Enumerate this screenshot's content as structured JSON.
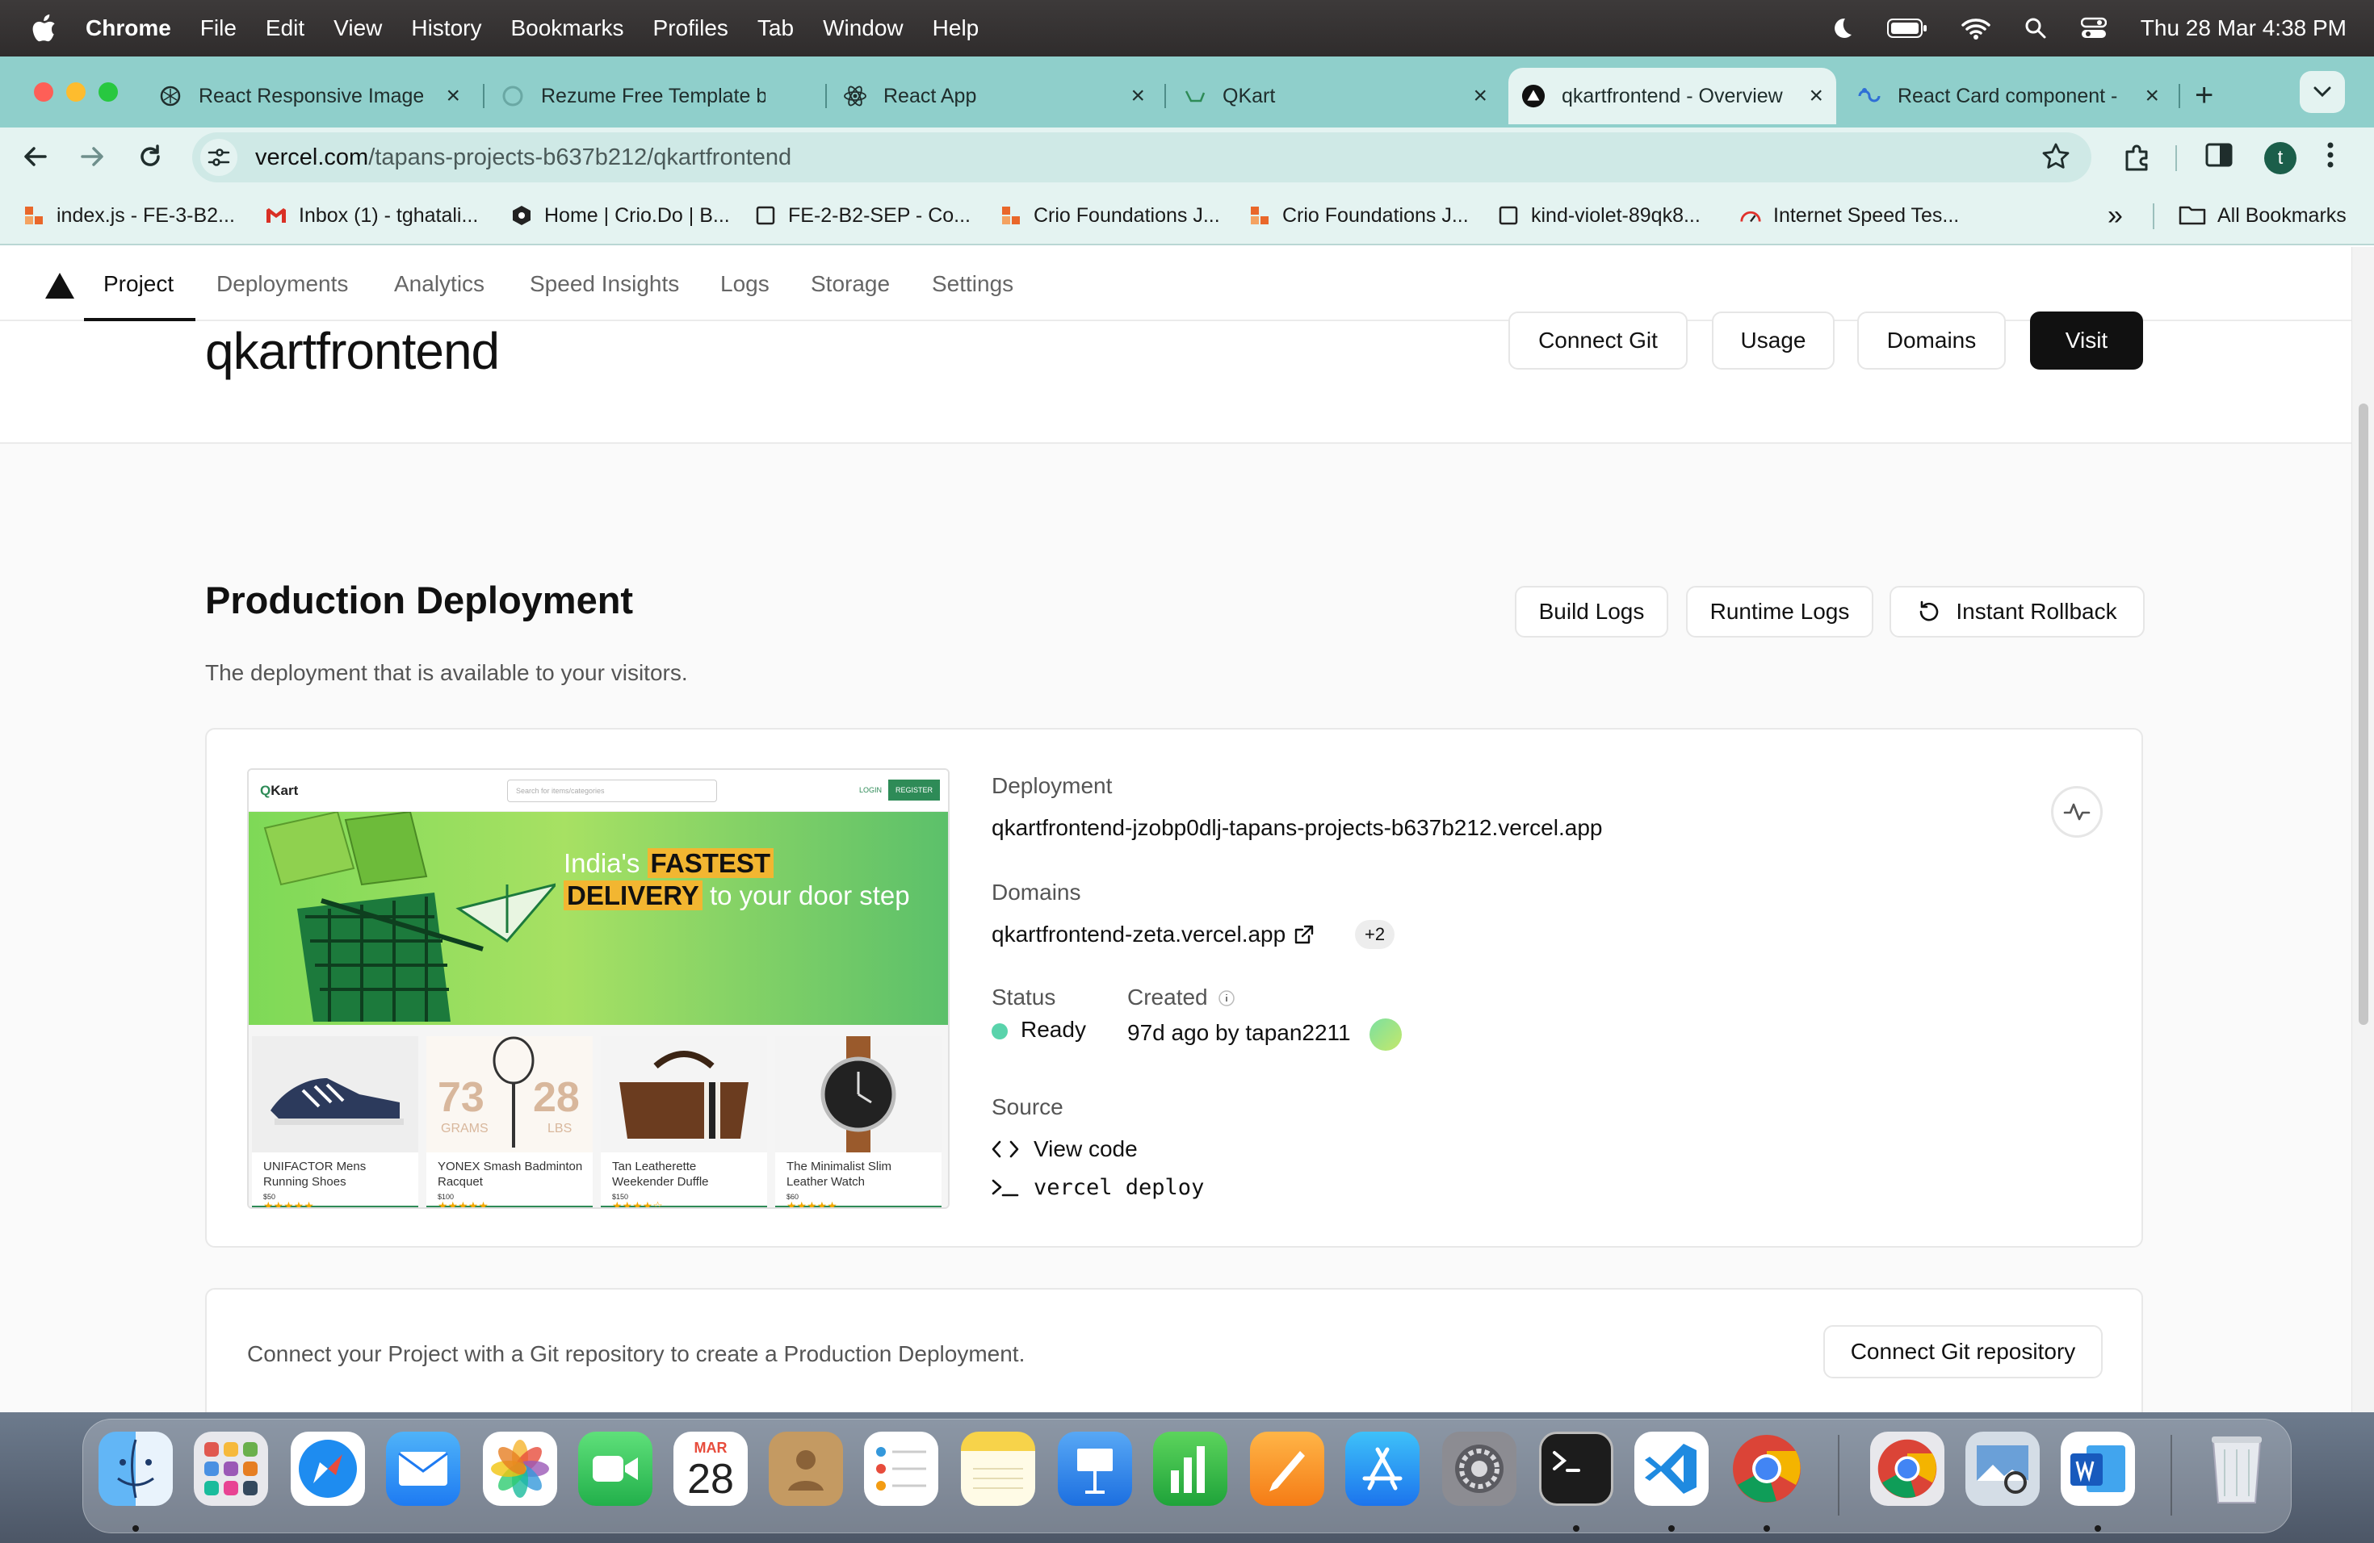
{
  "menubar": {
    "app": "Chrome",
    "items": [
      "File",
      "Edit",
      "View",
      "History",
      "Bookmarks",
      "Profiles",
      "Tab",
      "Window",
      "Help"
    ],
    "clock": "Thu 28 Mar  4:38 PM"
  },
  "tabs": [
    {
      "label": "React Responsive Image",
      "icon": "openai-icon"
    },
    {
      "label": "Rezume Free Template b",
      "icon": "loading-icon"
    },
    {
      "label": "React App",
      "icon": "react-icon"
    },
    {
      "label": "QKart",
      "icon": "qkart-icon"
    },
    {
      "label": "qkartfrontend - Overview",
      "icon": "vercel-icon",
      "active": true
    },
    {
      "label": "React Card component -",
      "icon": "react-card-icon"
    }
  ],
  "address": {
    "domain": "vercel.com",
    "path": "/tapans-projects-b637b212/qkartfrontend"
  },
  "profile_initial": "t",
  "bookmarks": {
    "items": [
      "index.js - FE-3-B2...",
      "Inbox (1) - tghatali...",
      "Home | Crio.Do | B...",
      "FE-2-B2-SEP - Co...",
      "Crio Foundations J...",
      "Crio Foundations J...",
      "kind-violet-89qk8...",
      "Internet Speed Tes..."
    ],
    "all": "All Bookmarks"
  },
  "subnav": [
    "Project",
    "Deployments",
    "Analytics",
    "Speed Insights",
    "Logs",
    "Storage",
    "Settings"
  ],
  "project": {
    "name": "qkartfrontend",
    "buttons": {
      "connect_git": "Connect Git",
      "usage": "Usage",
      "domains": "Domains",
      "visit": "Visit"
    }
  },
  "production": {
    "title": "Production Deployment",
    "description": "The deployment that is available to your visitors.",
    "buttons": {
      "build_logs": "Build Logs",
      "runtime_logs": "Runtime Logs",
      "rollback": "Instant Rollback"
    },
    "deployment_label": "Deployment",
    "deployment_url": "qkartfrontend-jzobp0dlj-tapans-projects-b637b212.vercel.app",
    "domains_label": "Domains",
    "domain": "qkartfrontend-zeta.vercel.app",
    "domain_extra": "+2",
    "status_label": "Status",
    "status": "Ready",
    "status_color": "#59d3ab",
    "created_label": "Created",
    "created": "97d ago by tapan2211",
    "source_label": "Source",
    "view_code": "View code",
    "deploy_cmd": "vercel deploy"
  },
  "preview": {
    "logo_prefix": "Q",
    "logo_rest": "Kart",
    "search_placeholder": "Search for items/categories",
    "login": "LOGIN",
    "register": "REGISTER",
    "banner_1": "India's ",
    "banner_2": "FASTEST",
    "banner_3": "DELIVERY",
    "banner_4": " to your door step",
    "products": [
      {
        "name": "UNIFACTOR Mens Running Shoes",
        "price": "$50",
        "stars": "★★★★★"
      },
      {
        "name": "YONEX Smash Badminton Racquet",
        "price": "$100",
        "stars": "★★★★★"
      },
      {
        "name": "Tan Leatherette Weekender Duffle",
        "price": "$150",
        "stars": "★★★★☆"
      },
      {
        "name": "The Minimalist Slim Leather Watch",
        "price": "$60",
        "stars": "★★★★★"
      }
    ],
    "racquet_text_1": "73",
    "racquet_text_2": "GRAMS",
    "racquet_text_3": "28",
    "racquet_text_4": "LBS"
  },
  "git_card": {
    "message": "Connect your Project with a Git repository to create a Production Deployment.",
    "button": "Connect Git repository"
  },
  "dock": {
    "calendar_month": "MAR",
    "calendar_day": "28",
    "apps": [
      "Finder",
      "Launchpad",
      "Safari",
      "Mail",
      "Photos",
      "FaceTime",
      "Calendar",
      "Contacts",
      "Reminders",
      "Notes",
      "Keynote",
      "Numbers",
      "Pages",
      "App Store",
      "System Settings",
      "Terminal",
      "VS Code",
      "Chrome",
      "Chrome",
      "Preview",
      "Word",
      "Trash"
    ]
  }
}
